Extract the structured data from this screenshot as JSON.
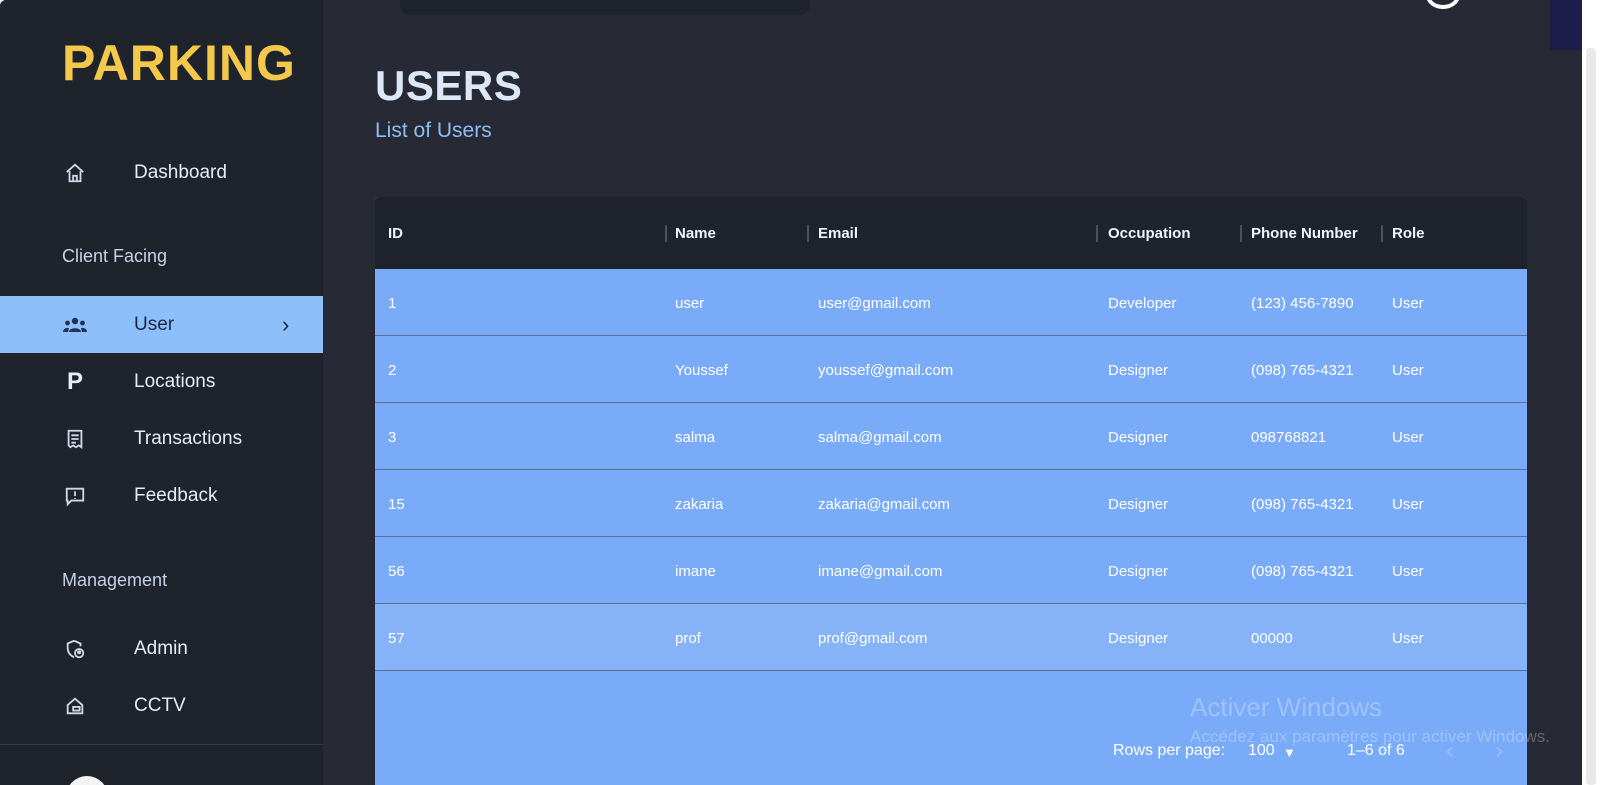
{
  "app": {
    "logo": "PARKING"
  },
  "sidebar": {
    "items_top": [
      {
        "label": "Dashboard",
        "icon": "home-icon"
      }
    ],
    "section_client": "Client Facing",
    "items_client": [
      {
        "label": "User",
        "icon": "users-icon",
        "active": true
      },
      {
        "label": "Locations",
        "icon": "parking-icon"
      },
      {
        "label": "Transactions",
        "icon": "receipt-icon"
      },
      {
        "label": "Feedback",
        "icon": "feedback-icon"
      }
    ],
    "section_management": "Management",
    "items_management": [
      {
        "label": "Admin",
        "icon": "admin-shield-icon"
      },
      {
        "label": "CCTV",
        "icon": "cctv-icon"
      }
    ]
  },
  "header": {
    "title": "USERS",
    "subtitle": "List of Users"
  },
  "grid": {
    "columns": [
      "ID",
      "Name",
      "Email",
      "Occupation",
      "Phone Number",
      "Role"
    ],
    "rows": [
      {
        "id": "1",
        "name": "user",
        "email": "user@gmail.com",
        "occupation": "Developer",
        "phone": "(123) 456-7890",
        "role": "User"
      },
      {
        "id": "2",
        "name": "Youssef",
        "email": "youssef@gmail.com",
        "occupation": "Designer",
        "phone": "(098) 765-4321",
        "role": "User"
      },
      {
        "id": "3",
        "name": "salma",
        "email": "salma@gmail.com",
        "occupation": "Designer",
        "phone": "098768821",
        "role": "User"
      },
      {
        "id": "15",
        "name": "zakaria",
        "email": "zakaria@gmail.com",
        "occupation": "Designer",
        "phone": "(098) 765-4321",
        "role": "User"
      },
      {
        "id": "56",
        "name": "imane",
        "email": "imane@gmail.com",
        "occupation": "Designer",
        "phone": "(098) 765-4321",
        "role": "User"
      },
      {
        "id": "57",
        "name": "prof",
        "email": "prof@gmail.com",
        "occupation": "Designer",
        "phone": "00000",
        "role": "User"
      }
    ],
    "footer": {
      "rows_per_page_label": "Rows per page:",
      "rows_per_page_value": "100",
      "range": "1–6 of 6"
    }
  },
  "watermark": {
    "line1": "Activer Windows",
    "line2": "Accédez aux paramètres pour activer Windows."
  },
  "colors": {
    "accent": "#8dc0fa",
    "logo": "#f4c84a",
    "grid_bg": "#7aabf8",
    "sidebar_bg": "#1f232c",
    "main_bg": "#272a35"
  }
}
